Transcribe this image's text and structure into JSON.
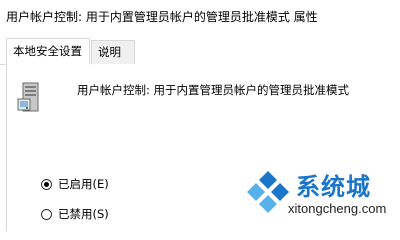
{
  "window": {
    "title": "用户帐户控制: 用于内置管理员帐户的管理员批准模式 属性"
  },
  "tabs": [
    {
      "label": "本地安全设置",
      "active": true
    },
    {
      "label": "说明",
      "active": false
    }
  ],
  "policy": {
    "icon": "server-computer-icon",
    "name": "用户帐户控制: 用于内置管理员帐户的管理员批准模式"
  },
  "options": [
    {
      "label": "已启用(E)",
      "selected": true
    },
    {
      "label": "已禁用(S)",
      "selected": false
    }
  ],
  "watermark": {
    "brand": "系统城",
    "url": "xitongcheng.com",
    "colors": {
      "blue": "#1b75c9",
      "light_blue": "#5ab0ea"
    }
  }
}
